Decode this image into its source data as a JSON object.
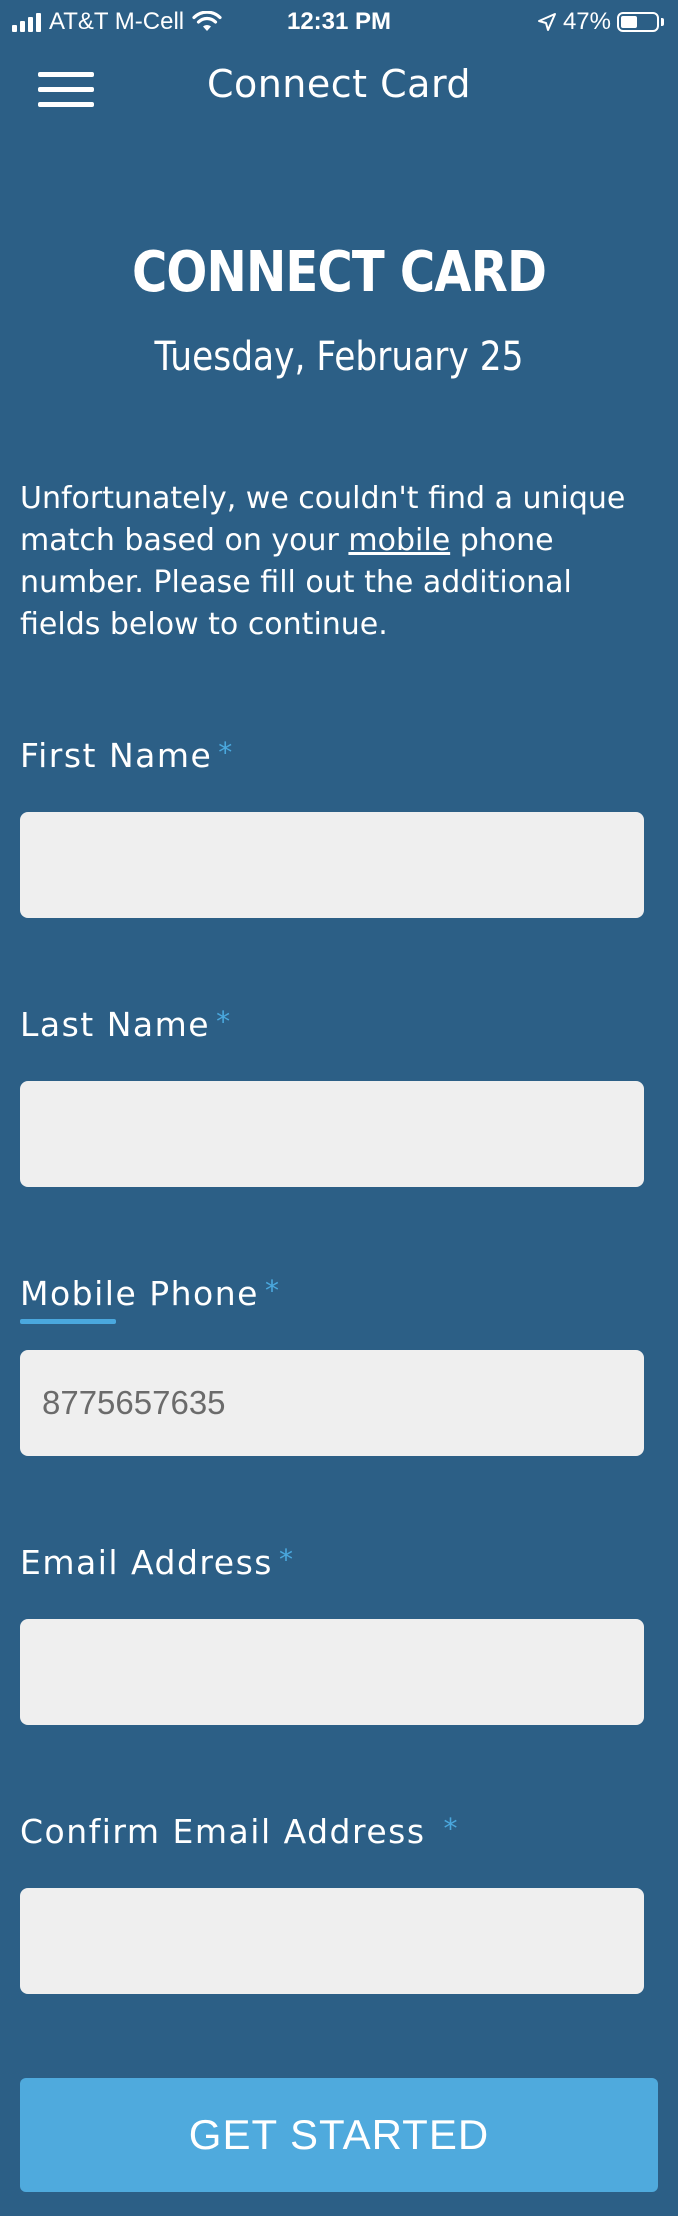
{
  "status_bar": {
    "carrier": "AT&T M-Cell",
    "time": "12:31 PM",
    "battery_percent": "47%",
    "battery_level": 0.47,
    "signal_bars": 4
  },
  "nav": {
    "title": "Connect Card",
    "menu_icon": "hamburger-icon"
  },
  "page": {
    "heading": "CONNECT CARD",
    "date": "Tuesday, February 25",
    "intro_before_link": "Unfortunately, we couldn't find a unique match based on your ",
    "intro_link": "mobile",
    "intro_after_link": " phone number. Please fill out the additional fields below to continue."
  },
  "form": {
    "required_marker": "*",
    "fields": [
      {
        "label": "First Name",
        "value": "",
        "placeholder": ""
      },
      {
        "label": "Last Name",
        "value": "",
        "placeholder": ""
      },
      {
        "label": "Mobile Phone",
        "value": "",
        "placeholder": "8775657635"
      },
      {
        "label": "Email Address",
        "value": "",
        "placeholder": ""
      },
      {
        "label": "Confirm Email Address",
        "value": "",
        "placeholder": ""
      }
    ],
    "submit_label": "GET STARTED"
  },
  "colors": {
    "background": "#2c5f86",
    "accent": "#4aa8de",
    "input_background": "#efefef",
    "button": "#4faadd"
  }
}
